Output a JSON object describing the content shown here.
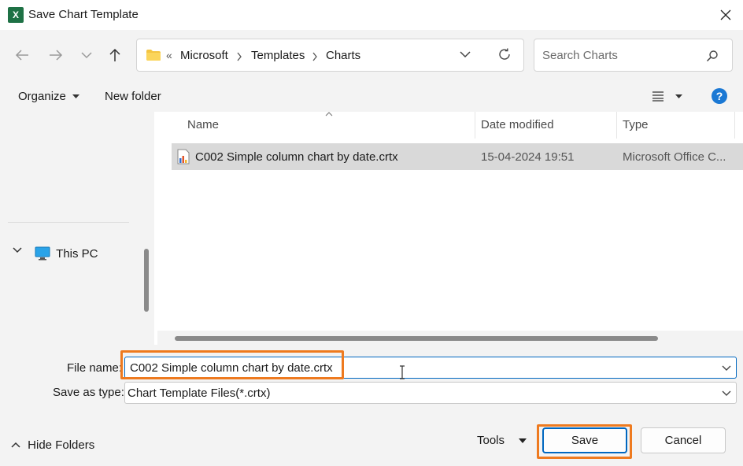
{
  "window": {
    "title": "Save Chart Template",
    "app_icon_letter": "X",
    "app_icon_color": "#1e7145"
  },
  "address": {
    "overflow": "«",
    "crumbs": [
      "Microsoft",
      "Templates",
      "Charts"
    ]
  },
  "search": {
    "placeholder": "Search Charts"
  },
  "toolbar": {
    "organize_label": "Organize",
    "new_folder_label": "New folder"
  },
  "nav": {
    "items": [
      {
        "label": "This PC",
        "icon": "computer-icon"
      }
    ]
  },
  "file_list": {
    "columns": [
      "Name",
      "Date modified",
      "Type"
    ],
    "rows": [
      {
        "name": "C002 Simple column chart by date.crtx",
        "date_modified": "15-04-2024 19:51",
        "type": "Microsoft Office C..."
      }
    ]
  },
  "form": {
    "file_name_label": "File name:",
    "file_name_value": "C002 Simple column chart by date.crtx",
    "save_as_type_label": "Save as type:",
    "save_as_type_value": "Chart Template Files(*.crtx)"
  },
  "footer": {
    "hide_folders_label": "Hide Folders",
    "tools_label": "Tools",
    "save_label": "Save",
    "cancel_label": "Cancel"
  },
  "colors": {
    "accent": "#0067c0",
    "highlight": "#ee7a1f",
    "selection": "#d9d9d9"
  }
}
